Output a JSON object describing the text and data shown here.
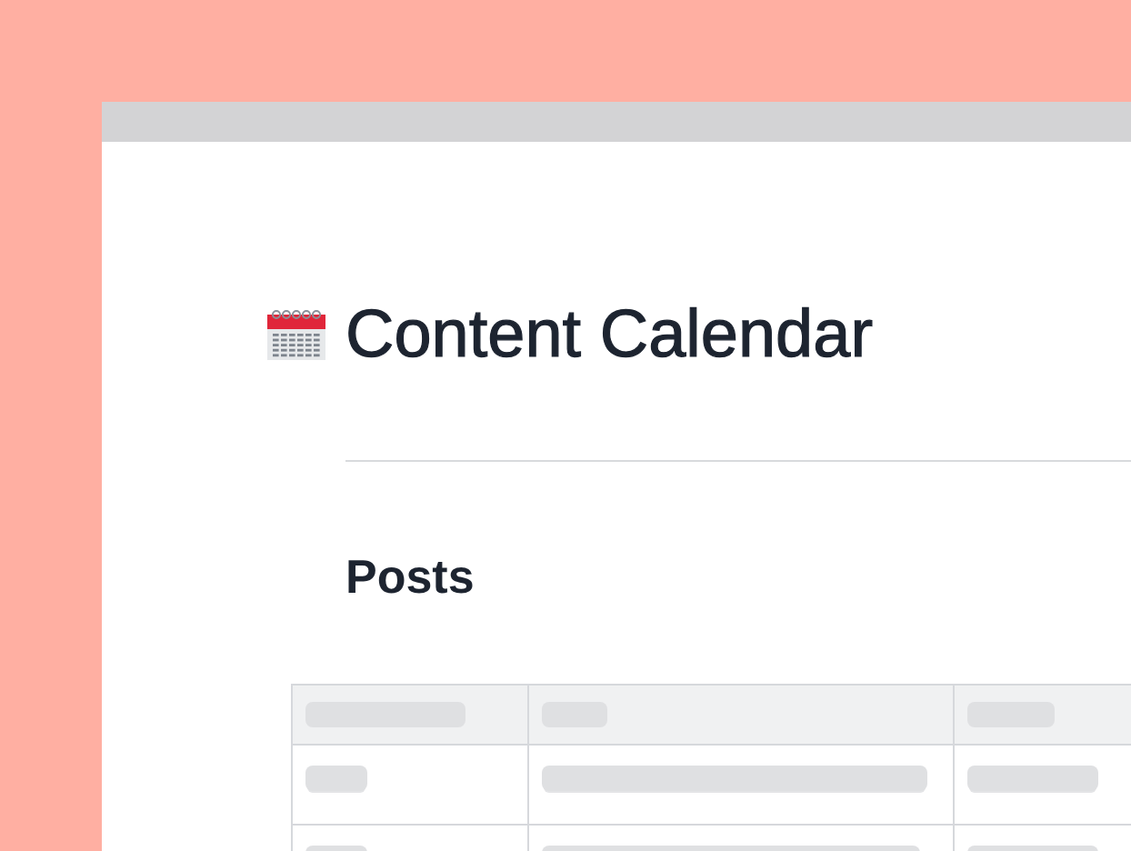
{
  "page": {
    "title": "Content Calendar"
  },
  "section": {
    "heading": "Posts"
  }
}
